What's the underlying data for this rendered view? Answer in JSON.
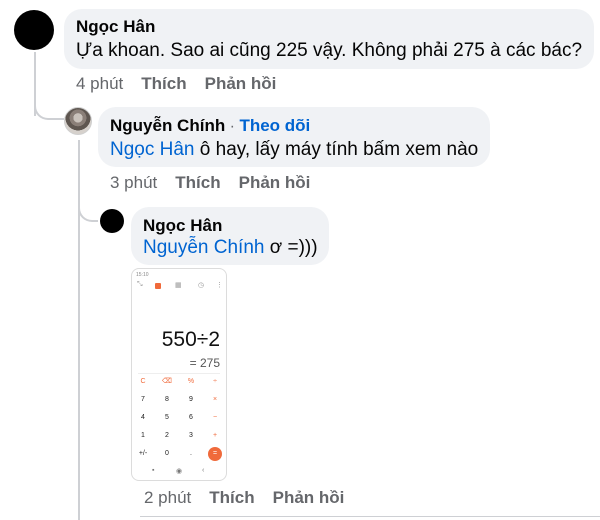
{
  "comments": [
    {
      "author": "Ngọc Hân",
      "text": "Ựa khoan. Sao ai cũng 225 vậy. Không phải 275 à các bác?",
      "time": "4 phút",
      "like": "Thích",
      "reply": "Phản hồi"
    },
    {
      "author": "Nguyễn Chính",
      "follow_sep": "·",
      "follow": "Theo dõi",
      "mention": "Ngọc Hân",
      "text": " ô hay, lấy máy tính bấm xem nào",
      "time": "3 phút",
      "like": "Thích",
      "reply": "Phản hồi"
    },
    {
      "author": "Ngọc Hân",
      "mention": "Nguyễn Chính",
      "text": " ơ =)))",
      "time": "2 phút",
      "like": "Thích",
      "reply": "Phản hồi"
    }
  ],
  "calculator": {
    "status_time": "15:10",
    "expression": "550÷2",
    "result": "= 275",
    "keys": [
      [
        "C",
        "⌫",
        "%",
        "÷"
      ],
      [
        "7",
        "8",
        "9",
        "×"
      ],
      [
        "4",
        "5",
        "6",
        "−"
      ],
      [
        "1",
        "2",
        "3",
        "+"
      ],
      [
        "+/-",
        "0",
        ".",
        "="
      ]
    ],
    "accent_color": "#f06a3b"
  },
  "colors": {
    "link": "#0064d1",
    "meta": "#65676b",
    "bubble": "#f0f2f5"
  }
}
